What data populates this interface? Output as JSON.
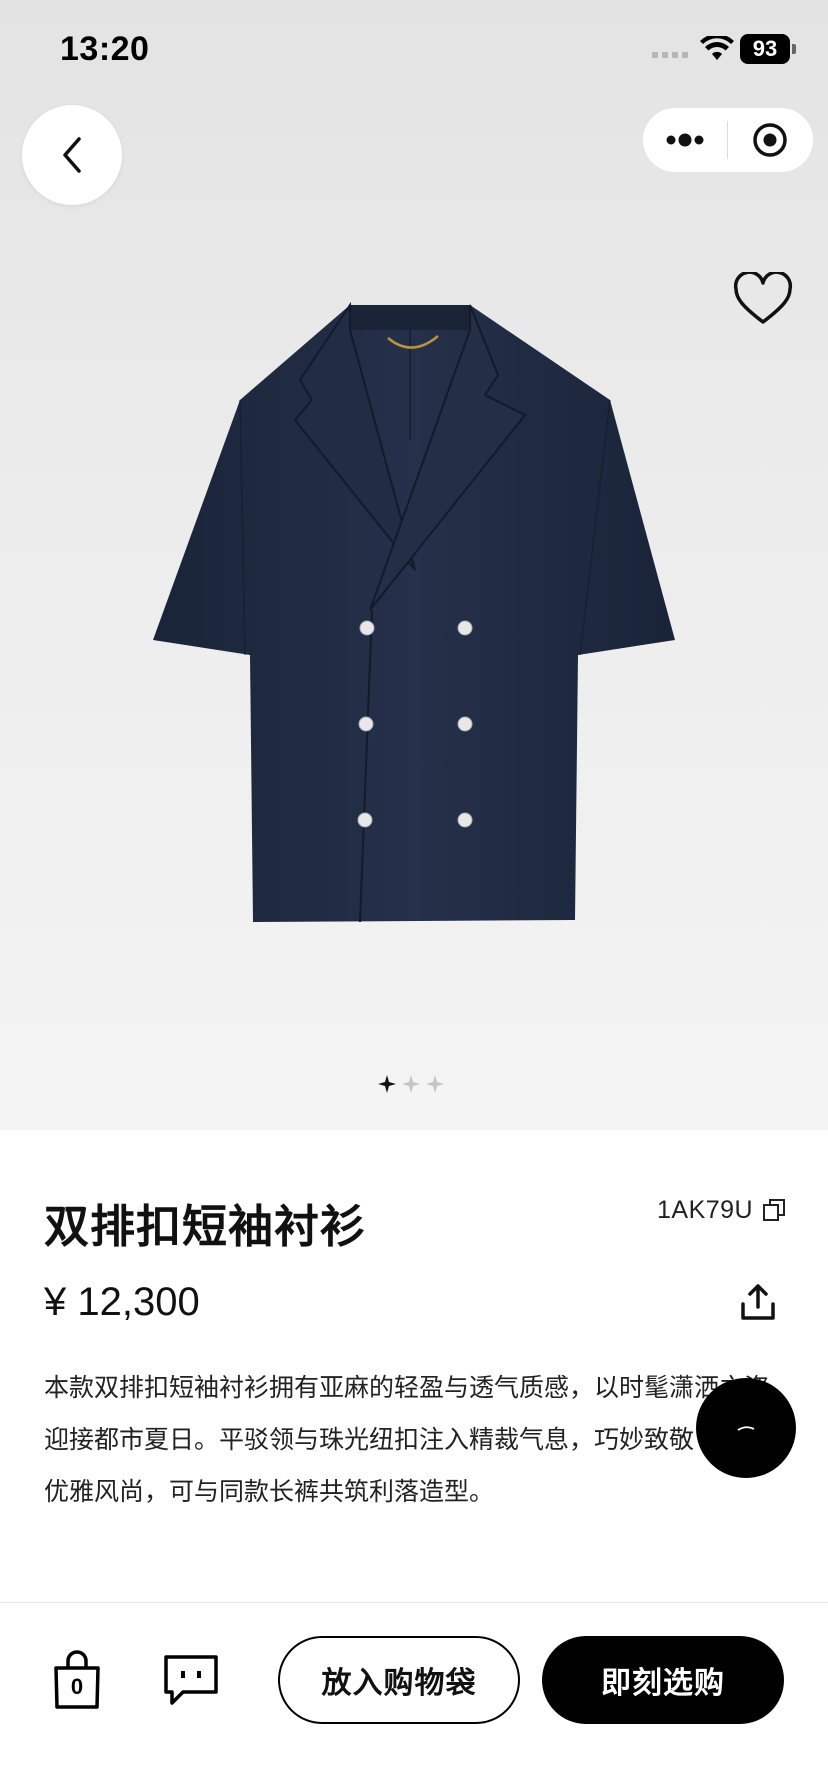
{
  "status_bar": {
    "time": "13:20",
    "battery": "93"
  },
  "product": {
    "title": "双排扣短袖衬衫",
    "sku": "1AK79U",
    "price": "¥ 12,300",
    "description": "本款双排扣短袖衬衫拥有亚麻的轻盈与透气质感，以时髦潇洒之姿迎接都市夏日。平驳领与珠光纽扣注入精裁气息，巧妙致敬 年代的优雅风尚，可与同款长裤共筑利落造型。",
    "image_count": 3,
    "current_image": 1
  },
  "bottom_bar": {
    "bag_count": "0",
    "add_to_bag_label": "放入购物袋",
    "buy_now_label": "即刻选购"
  },
  "colors": {
    "accent": "#000000",
    "garment": "#1f2a40"
  },
  "icons": [
    "back-chevron-icon",
    "more-dots-icon",
    "record-target-icon",
    "heart-icon",
    "copy-icon",
    "share-icon",
    "shopping-bag-icon",
    "chat-icon"
  ]
}
